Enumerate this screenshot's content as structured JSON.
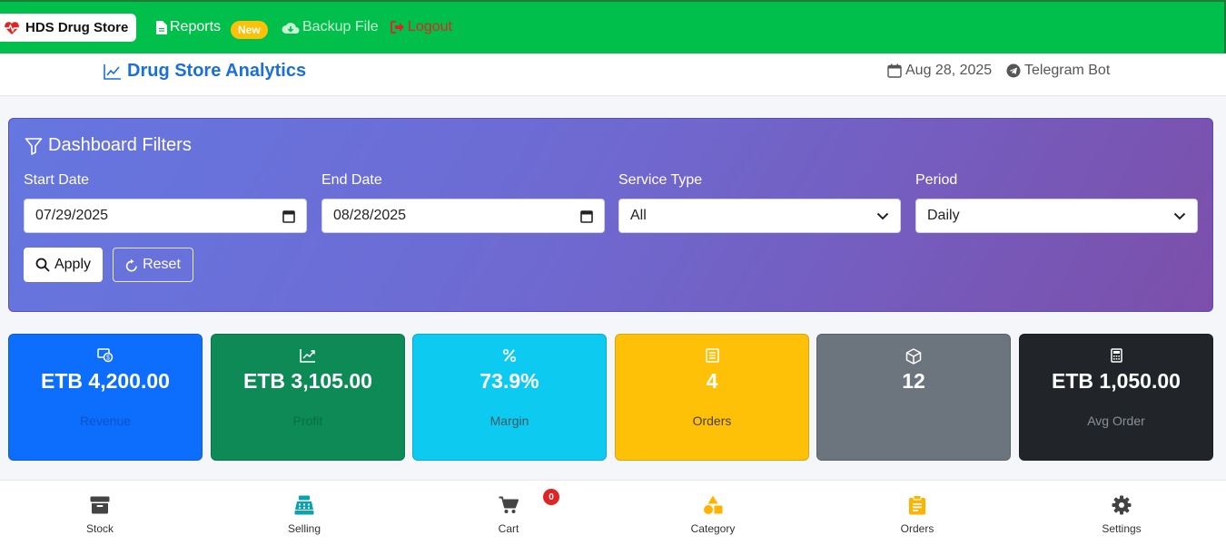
{
  "nav": {
    "brand": "HDS Drug Store",
    "reports": "Reports",
    "new_badge": "New",
    "backup": "Backup File",
    "logout": "Logout"
  },
  "header": {
    "title": "Drug Store Analytics",
    "date": "Aug 28, 2025",
    "bot": "Telegram Bot"
  },
  "filters": {
    "title": "Dashboard Filters",
    "start_label": "Start Date",
    "start_value": "07/29/2025",
    "end_label": "End Date",
    "end_value": "08/28/2025",
    "service_label": "Service Type",
    "service_value": "All",
    "period_label": "Period",
    "period_value": "Daily",
    "apply": "Apply",
    "reset": "Reset"
  },
  "cards": [
    {
      "value": "ETB 4,200.00",
      "label": "Revenue",
      "bg": "#0d6efd",
      "label_color": "#0a55c4",
      "icon": "money-icon"
    },
    {
      "value": "ETB 3,105.00",
      "label": "Profit",
      "bg": "#0d8a55",
      "label_color": "#0b6e44",
      "icon": "chart-up-icon"
    },
    {
      "value": "73.9%",
      "label": "Margin",
      "bg": "#0dcaf0",
      "label_color": "#3a5a66",
      "icon": "percent-icon"
    },
    {
      "value": "4",
      "label": "Orders",
      "bg": "#ffc107",
      "label_color": "#4a4030",
      "icon": "list-icon"
    },
    {
      "value": "12",
      "label": "",
      "bg": "#6c757d",
      "label_color": "#cfd3d6",
      "icon": "box-icon"
    },
    {
      "value": "ETB 1,050.00",
      "label": "Avg Order",
      "bg": "#212529",
      "label_color": "#8a9097",
      "icon": "calculator-icon"
    }
  ],
  "bottom_nav": {
    "stock": "Stock",
    "selling": "Selling",
    "cart": "Cart",
    "cart_count": "0",
    "category": "Category",
    "orders": "Orders",
    "settings": "Settings"
  }
}
